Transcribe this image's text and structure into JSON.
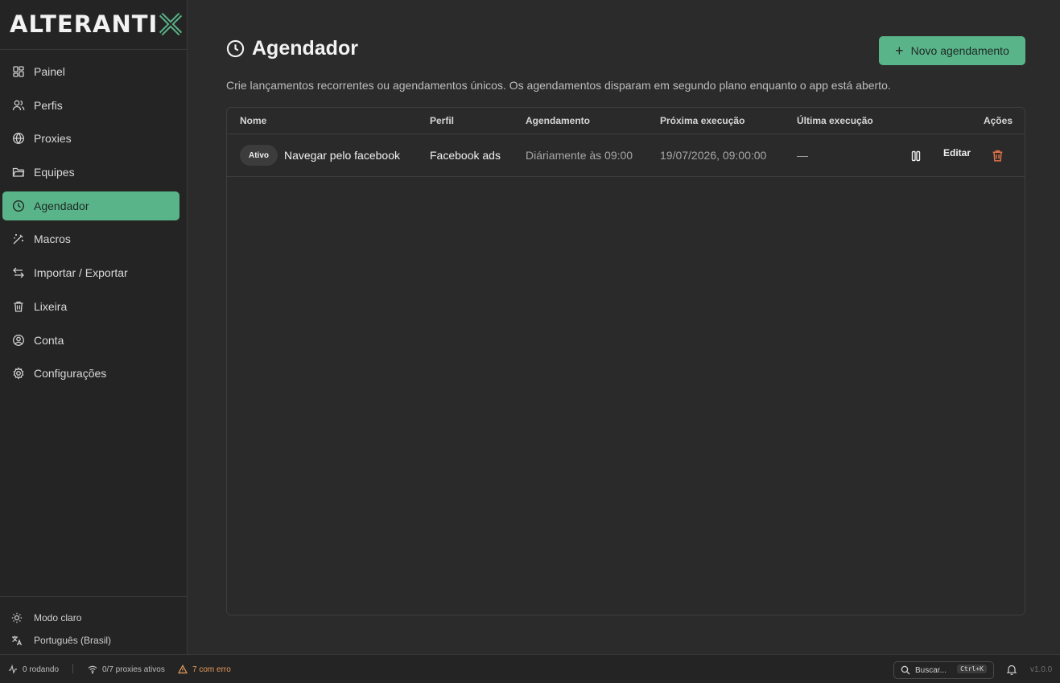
{
  "brand": {
    "logo_text": "ALTERANTI",
    "logo_accent_color": "#5ab489"
  },
  "sidebar": {
    "items": [
      {
        "label": "Painel",
        "icon": "dashboard-icon"
      },
      {
        "label": "Perfis",
        "icon": "users-icon"
      },
      {
        "label": "Proxies",
        "icon": "globe-icon"
      },
      {
        "label": "Equipes",
        "icon": "folder-icon"
      },
      {
        "label": "Agendador",
        "icon": "clock-icon",
        "active": true
      },
      {
        "label": "Macros",
        "icon": "magic-wand-icon"
      },
      {
        "label": "Importar / Exportar",
        "icon": "arrows-icon"
      },
      {
        "label": "Lixeira",
        "icon": "trash-icon"
      },
      {
        "label": "Conta",
        "icon": "user-circle-icon"
      },
      {
        "label": "Configurações",
        "icon": "gear-icon"
      }
    ],
    "bottom": {
      "theme_label": "Modo claro",
      "language_label": "Português (Brasil)"
    }
  },
  "page": {
    "title": "Agendador",
    "subtitle": "Crie lançamentos recorrentes ou agendamentos únicos. Os agendamentos disparam em segundo plano enquanto o app está aberto.",
    "new_button_label": "Novo agendamento"
  },
  "table": {
    "columns": {
      "name": "Nome",
      "profile": "Perfil",
      "schedule": "Agendamento",
      "next": "Próxima execução",
      "last": "Última execução",
      "actions": "Ações"
    },
    "rows": [
      {
        "status": "Ativo",
        "name": "Navegar pelo facebook",
        "profile": "Facebook ads",
        "schedule": "Diáriamente às 09:00",
        "next": "19/07/2026, 09:00:00",
        "last": "—",
        "edit_label": "Editar"
      }
    ]
  },
  "statusbar": {
    "running": "0 rodando",
    "proxies": "0/7 proxies ativos",
    "errors": "7 com erro",
    "search_placeholder": "Buscar...",
    "shortcut": "Ctrl+K",
    "version": "v1.0.0"
  },
  "colors": {
    "accent": "#5ab489",
    "danger": "#e0714a",
    "warning": "#e59a5b"
  }
}
